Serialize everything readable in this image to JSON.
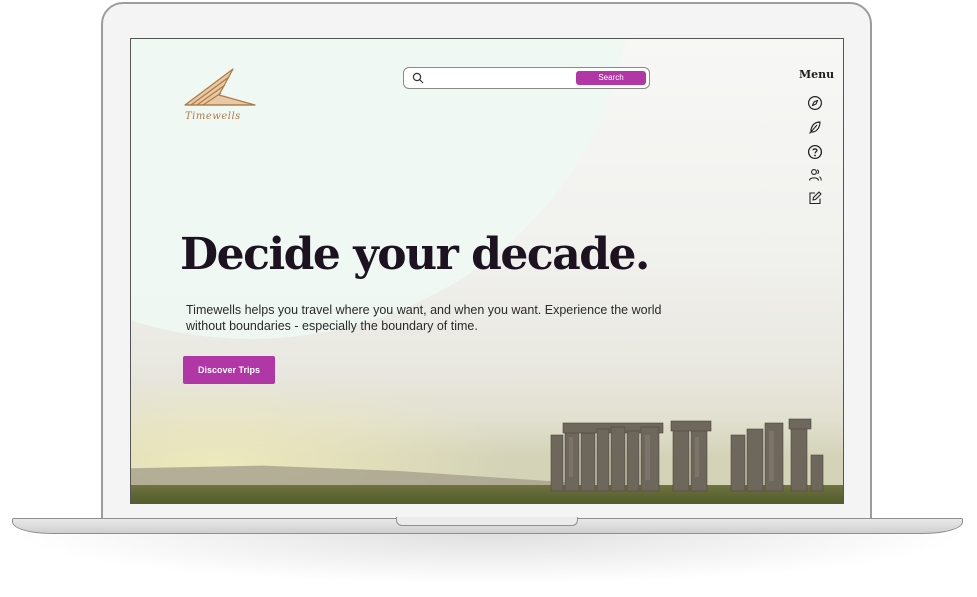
{
  "brand": {
    "name": "Timewells",
    "color": "#b07a44"
  },
  "search": {
    "placeholder": "",
    "button_label": "Search"
  },
  "menu": {
    "label": "Menu",
    "icons": [
      "compass-icon",
      "feather-icon",
      "help-icon",
      "users-icon",
      "edit-icon"
    ]
  },
  "hero": {
    "headline": "Decide your decade.",
    "subtext": "Timewells helps you travel where you want, and when you want. Experience the world without boundaries - especially the boundary of time.",
    "cta_label": "Discover Trips"
  },
  "colors": {
    "accent": "#b136a6",
    "mint": "#eef8f2",
    "headline": "#1d1320"
  }
}
